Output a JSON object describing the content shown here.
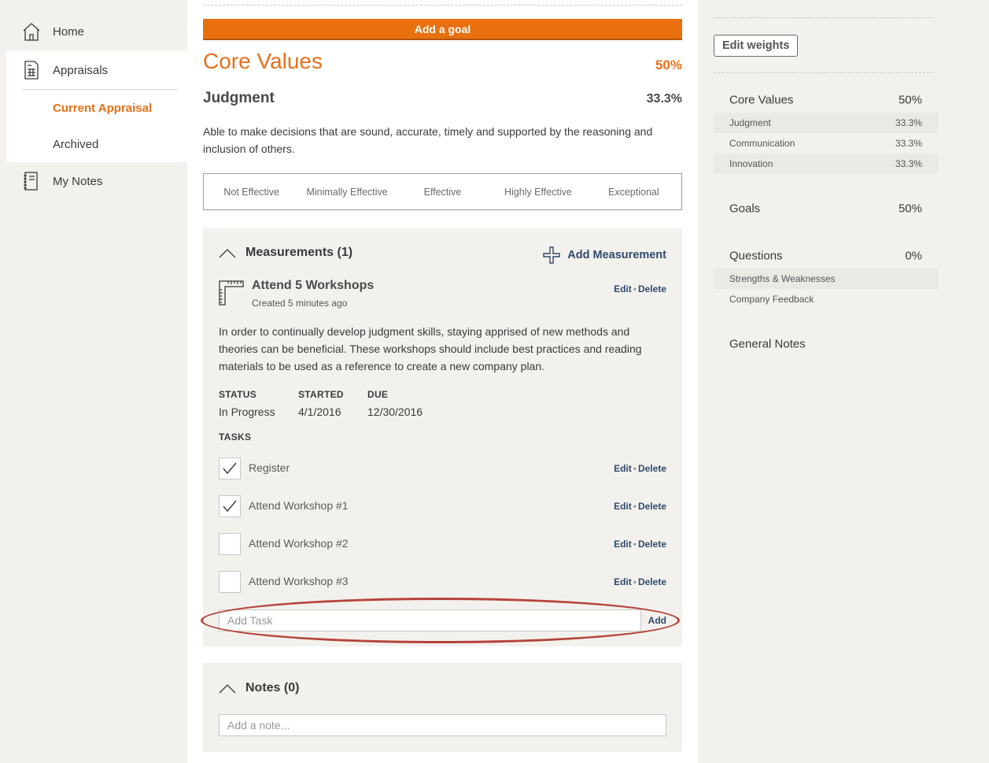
{
  "sidebar": {
    "items": [
      {
        "label": "Home",
        "icon": "home-icon"
      },
      {
        "label": "Appraisals",
        "icon": "appraisal-icon"
      },
      {
        "label": "My Notes",
        "icon": "notebook-icon"
      }
    ],
    "sub_items": [
      {
        "label": "Current Appraisal",
        "active": true
      },
      {
        "label": "Archived",
        "active": false
      }
    ]
  },
  "main": {
    "add_goal_label": "Add a goal",
    "section_title": "Core Values",
    "section_pct": "50%",
    "value_title": "Judgment",
    "value_pct": "33.3%",
    "value_desc": "Able to make decisions that are sound, accurate, timely and supported by the reasoning and inclusion of others.",
    "ratings": [
      "Not Effective",
      "Minimally Effective",
      "Effective",
      "Highly Effective",
      "Exceptional"
    ],
    "measurements": {
      "header": "Measurements (1)",
      "add_label": "Add Measurement",
      "item": {
        "title": "Attend 5 Workshops",
        "created": "Created 5 minutes ago",
        "edit": "Edit",
        "sep": "•",
        "delete": "Delete",
        "description": "In order to continually develop judgment skills, staying apprised of new methods and theories can be beneficial. These workshops should include best practices and reading materials to be used as a reference to create a new company plan.",
        "status_label": "STATUS",
        "status_value": "In Progress",
        "started_label": "STARTED",
        "started_value": "4/1/2016",
        "due_label": "DUE",
        "due_value": "12/30/2016",
        "tasks_label": "TASKS",
        "tasks": [
          {
            "label": "Register",
            "checked": true
          },
          {
            "label": "Attend Workshop #1",
            "checked": true
          },
          {
            "label": "Attend Workshop #2",
            "checked": false
          },
          {
            "label": "Attend Workshop #3",
            "checked": false
          }
        ],
        "add_task_placeholder": "Add Task",
        "add_task_button": "Add"
      }
    },
    "notes": {
      "header": "Notes (0)",
      "placeholder": "Add a note..."
    }
  },
  "weights": {
    "edit_label": "Edit weights",
    "core_values": {
      "label": "Core Values",
      "value": "50%"
    },
    "core_items": [
      {
        "label": "Judgment",
        "value": "33.3%"
      },
      {
        "label": "Communication",
        "value": "33.3%"
      },
      {
        "label": "Innovation",
        "value": "33.3%"
      }
    ],
    "goals": {
      "label": "Goals",
      "value": "50%"
    },
    "questions": {
      "label": "Questions",
      "value": "0%"
    },
    "question_items": [
      {
        "label": "Strengths & Weaknesses"
      },
      {
        "label": "Company Feedback"
      }
    ],
    "general_notes": "General Notes"
  },
  "colors": {
    "accent": "#e8701a",
    "link": "#2f4a6e",
    "highlight_ring": "#b5443a"
  }
}
